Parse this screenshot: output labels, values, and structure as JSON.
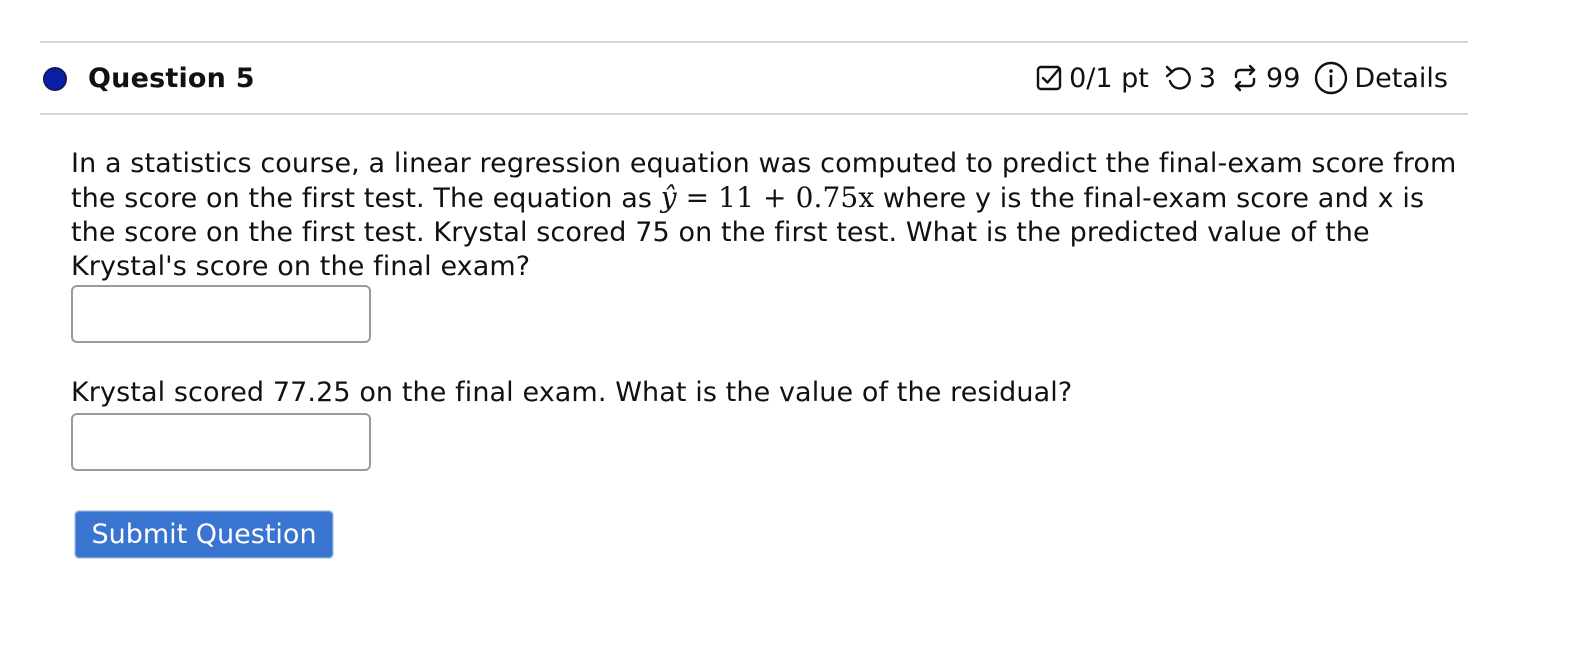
{
  "question": {
    "title": "Question 5",
    "status_color": "#0a1ea8",
    "score": "0/1 pt",
    "retries": "3",
    "attempts": "99",
    "details_label": "Details",
    "icons": {
      "score": "checkbox-icon",
      "retries": "undo-icon",
      "attempts": "repeat-icon",
      "details": "info-icon"
    }
  },
  "prompt": {
    "text_before": "In a statistics course, a linear regression equation was computed to predict the final-exam score from the score on the first test. The equation as ",
    "equation_lhs": "ŷ",
    "equation_rhs": " = 11 + 0.75x",
    "text_after": " where y is the final-exam score and x is the score on the first test. Krystal scored 75 on the first test. What is the predicted value of the Krystal's score on the final exam?"
  },
  "answer1": {
    "value": "",
    "placeholder": ""
  },
  "part2": {
    "text": "Krystal scored 77.25 on the final exam. What is the value of the residual?"
  },
  "answer2": {
    "value": "",
    "placeholder": ""
  },
  "submit_label": "Submit Question",
  "colors": {
    "accent": "#3a74d1",
    "divider": "#d6d6d6"
  }
}
